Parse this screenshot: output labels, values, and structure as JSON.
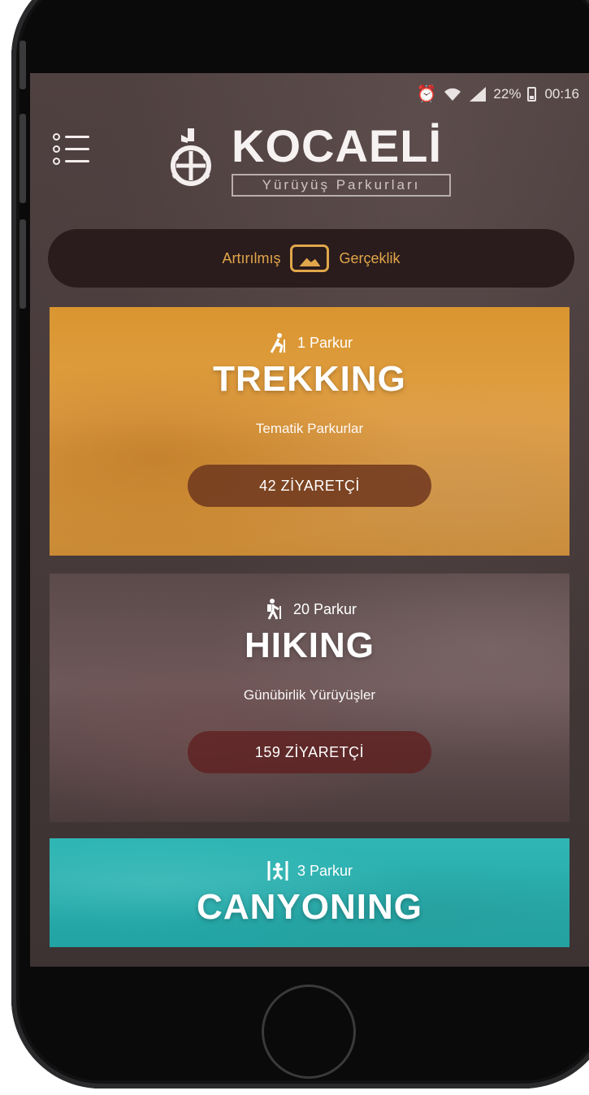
{
  "status_bar": {
    "alarm_icon": "alarm-icon",
    "wifi_icon": "wifi-icon",
    "signal_icon": "signal-icon",
    "battery": "22%",
    "time": "00:16"
  },
  "header": {
    "title": "KOCAELİ",
    "subtitle": "Yürüyüş Parkurları",
    "menu_icon": "list-menu-icon"
  },
  "ar_button": {
    "left_label": "Artırılmış",
    "right_label": "Gerçeklik",
    "icon": "ar-camera-icon"
  },
  "categories": [
    {
      "count_label": "1 Parkur",
      "title": "TREKKING",
      "subtitle": "Tematik Parkurlar",
      "visitors": "42 ZİYARETÇİ",
      "icon": "trekking-icon",
      "color": "#E2A045"
    },
    {
      "count_label": "20 Parkur",
      "title": "HIKING",
      "subtitle": "Günübirlik Yürüyüşler",
      "visitors": "159 ZİYARETÇİ",
      "icon": "hiking-icon",
      "color": "#5B4A4B"
    },
    {
      "count_label": "3 Parkur",
      "title": "CANYONING",
      "icon": "canyoning-icon",
      "color": "#2FB7B5"
    }
  ]
}
